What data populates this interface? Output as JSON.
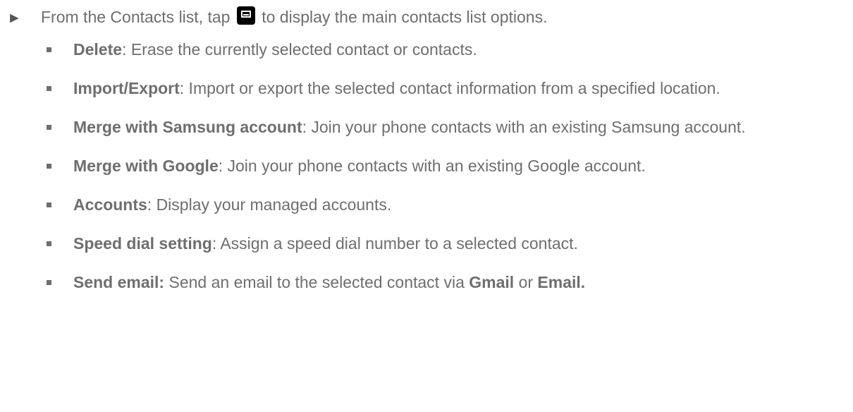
{
  "intro": {
    "arrow": "►",
    "text_before": "From the Contacts list, tap",
    "icon": "menu-icon",
    "text_after": "to display the main contacts list options."
  },
  "options": [
    {
      "term": "Delete",
      "description": ": Erase the currently selected contact or contacts."
    },
    {
      "term": "Import/Export",
      "description": ": Import or export the selected contact information from a specified location."
    },
    {
      "term": "Merge with Samsung account",
      "description": ": Join your phone contacts with an existing Samsung account."
    },
    {
      "term": "Merge with Google",
      "description": ": Join your phone contacts with an existing Google account."
    },
    {
      "term": "Accounts",
      "description": ": Display your managed accounts."
    },
    {
      "term": "Speed dial setting",
      "description": ": Assign a speed dial number to a selected contact."
    }
  ],
  "last_option": {
    "term": "Send email:",
    "text_1": " Send an email to the selected contact via ",
    "app_1": "Gmail",
    "text_2": " or ",
    "app_2": "Email."
  }
}
